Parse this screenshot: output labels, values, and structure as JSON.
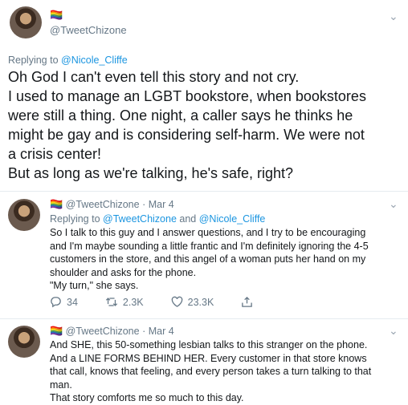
{
  "tweet1": {
    "emoji": "🏳️‍🌈",
    "handle": "@TweetChizone",
    "replying_prefix": "Replying to ",
    "replying_to": "@Nicole_Cliffe",
    "lines": [
      "Oh God I can't even tell this story and not cry.",
      "I used to manage an LGBT bookstore, when bookstores",
      "were still a thing. One night, a caller says he thinks he",
      "might be gay and is considering self-harm. We were not",
      "a crisis center!",
      "But as long as we're talking, he's safe, right?"
    ]
  },
  "tweet2": {
    "emoji": "🏳️‍🌈",
    "handle": "@TweetChizone",
    "dot": "·",
    "date": "Mar 4",
    "replying_prefix": "Replying to ",
    "replying_to_1": "@TweetChizone",
    "and": " and ",
    "replying_to_2": "@Nicole_Cliffe",
    "lines": [
      "So I talk to this guy and I answer questions, and I try to be encouraging",
      "and I'm maybe sounding a little frantic and I'm definitely ignoring the 4-5",
      "customers in the store, and this angel of a woman puts her hand on my",
      "shoulder and asks for the phone.",
      "\"My turn,\" she says."
    ],
    "replies": "34",
    "retweets": "2.3K",
    "likes": "23.3K"
  },
  "tweet3": {
    "emoji": "🏳️‍🌈",
    "handle": "@TweetChizone",
    "dot": "·",
    "date": "Mar 4",
    "lines": [
      "And SHE, this 50-something lesbian talks to this stranger on the phone.",
      "And a LINE FORMS BEHIND HER. Every customer in that store knows",
      "that call, knows that feeling, and every person takes a turn talking to that",
      "man.",
      "That story comforts me so much to this day."
    ]
  },
  "icons": [
    "chevron-down-icon",
    "reply-icon",
    "retweet-icon",
    "like-icon",
    "share-icon"
  ]
}
